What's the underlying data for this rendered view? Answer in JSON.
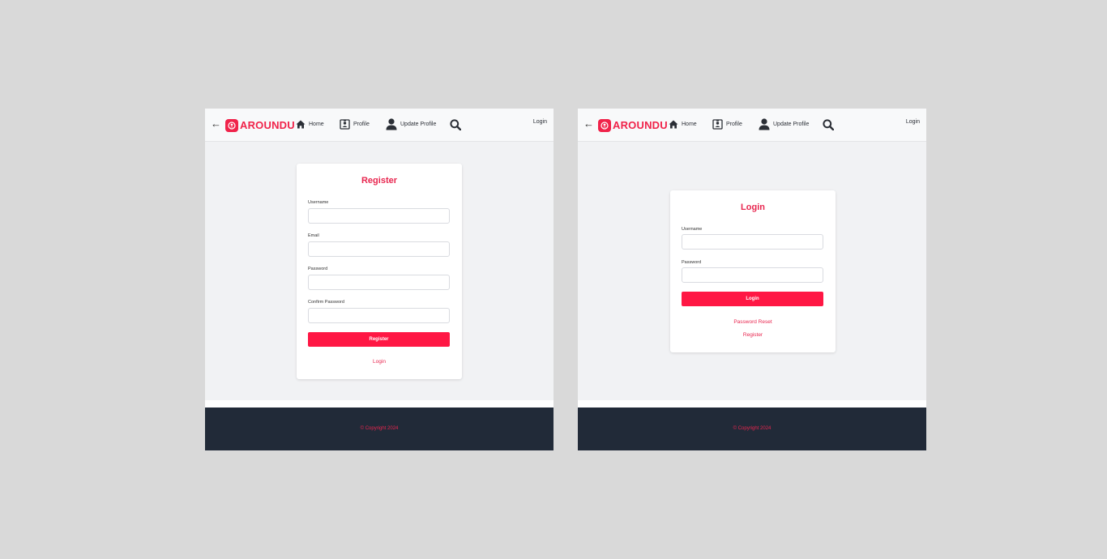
{
  "theme": {
    "accent": "#f0234a",
    "button": "#ff1744",
    "footer_bg": "#212a38",
    "page_bg": "#f1f2f4",
    "backdrop": "#d9d9d9"
  },
  "screens": [
    {
      "name": "register-screen",
      "navbar": {
        "back_icon": "back-arrow-icon",
        "back_glyph": "←",
        "brand": "AROUNDU",
        "home": "Home",
        "profile": "Profile",
        "update_profile": "Update Profile",
        "login": "Login"
      },
      "form": {
        "title": "Register",
        "fields": [
          {
            "label": "Username",
            "value": "",
            "placeholder": ""
          },
          {
            "label": "Email",
            "value": "",
            "placeholder": ""
          },
          {
            "label": "Password",
            "value": "",
            "placeholder": ""
          },
          {
            "label": "Confirm Password",
            "value": "",
            "placeholder": ""
          }
        ],
        "submit_label": "Register",
        "links": [
          "Login"
        ]
      },
      "footer": {
        "text": "© Copyright 2024"
      }
    },
    {
      "name": "login-screen",
      "navbar": {
        "back_icon": "back-arrow-icon",
        "back_glyph": "←",
        "brand": "AROUNDU",
        "home": "Home",
        "profile": "Profile",
        "update_profile": "Update Profile",
        "login": "Login"
      },
      "form": {
        "title": "Login",
        "fields": [
          {
            "label": "Username",
            "value": "",
            "placeholder": ""
          },
          {
            "label": "Password",
            "value": "",
            "placeholder": ""
          }
        ],
        "submit_label": "Login",
        "links": [
          "Password Reset",
          "Register"
        ]
      },
      "footer": {
        "text": "© Copyright 2024"
      }
    }
  ]
}
